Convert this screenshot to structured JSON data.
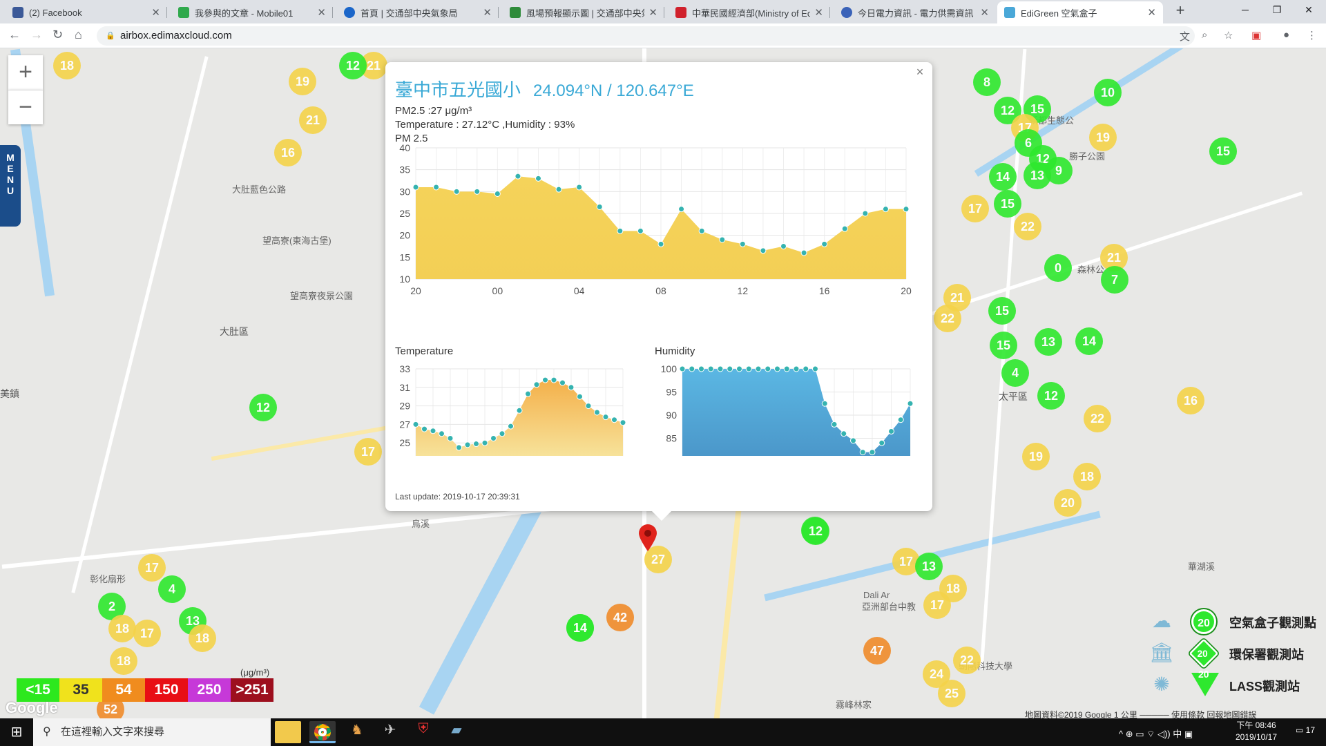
{
  "browser": {
    "tabs": [
      {
        "label": "(2) Facebook",
        "color": "#3b5998"
      },
      {
        "label": "我參與的文章 - Mobile01",
        "color": "#2fa94c"
      },
      {
        "label": "首頁 | 交通部中央氣象局",
        "color": "#1b66c9"
      },
      {
        "label": "風場預報顯示圖 | 交通部中央氣象",
        "color": "#2e8b3a"
      },
      {
        "label": "中華民國經濟部(Ministry of Eco",
        "color": "#d0212c"
      },
      {
        "label": "今日電力資訊 - 電力供需資訊 - 台",
        "color": "#3a62b8"
      },
      {
        "label": "EdiGreen 空氣盒子",
        "color": "#4aa8d8"
      }
    ],
    "new_tab": "+",
    "url": "airbox.edimaxcloud.com"
  },
  "map": {
    "labels": [
      {
        "t": "大肚藍色公路"
      },
      {
        "t": "望高寮(東海古堡)"
      },
      {
        "t": "望高寮夜景公園"
      },
      {
        "t": "大肚區"
      },
      {
        "t": "美鎮"
      },
      {
        "t": "太平區"
      },
      {
        "t": "新都生態公"
      },
      {
        "t": "勝子公園"
      },
      {
        "t": "霧峰林家"
      },
      {
        "t": "亞洲部台中教"
      },
      {
        "t": "朝陽科技大學"
      },
      {
        "t": "Dali Ar"
      },
      {
        "t": "烏溪"
      },
      {
        "t": "華湖溪"
      },
      {
        "t": "森林公"
      },
      {
        "t": "彰化扇形"
      }
    ],
    "markers": [
      {
        "v": "18",
        "c": "y"
      },
      {
        "v": "19",
        "c": "y"
      },
      {
        "v": "21",
        "c": "y"
      },
      {
        "v": "16",
        "c": "y"
      },
      {
        "v": "12",
        "c": "g"
      },
      {
        "v": "21",
        "c": "y"
      },
      {
        "v": "12",
        "c": "g"
      },
      {
        "v": "17",
        "c": "y"
      },
      {
        "v": "17",
        "c": "y"
      },
      {
        "v": "4",
        "c": "g"
      },
      {
        "v": "2",
        "c": "g"
      },
      {
        "v": "18",
        "c": "y"
      },
      {
        "v": "17",
        "c": "y"
      },
      {
        "v": "13",
        "c": "g"
      },
      {
        "v": "18",
        "c": "y"
      },
      {
        "v": "18",
        "c": "y"
      },
      {
        "v": "14",
        "c": "g"
      },
      {
        "v": "42",
        "c": "o"
      },
      {
        "v": "27",
        "c": "y"
      },
      {
        "v": "12",
        "c": "g"
      },
      {
        "v": "17",
        "c": "y"
      },
      {
        "v": "13",
        "c": "g"
      },
      {
        "v": "18",
        "c": "y"
      },
      {
        "v": "17",
        "c": "y"
      },
      {
        "v": "47",
        "c": "o"
      },
      {
        "v": "22",
        "c": "y"
      },
      {
        "v": "24",
        "c": "y"
      },
      {
        "v": "25",
        "c": "y"
      },
      {
        "v": "8",
        "c": "g"
      },
      {
        "v": "10",
        "c": "g"
      },
      {
        "v": "12",
        "c": "g"
      },
      {
        "v": "15",
        "c": "g"
      },
      {
        "v": "17",
        "c": "y"
      },
      {
        "v": "19",
        "c": "y"
      },
      {
        "v": "15",
        "c": "g"
      },
      {
        "v": "6",
        "c": "g"
      },
      {
        "v": "12",
        "c": "g"
      },
      {
        "v": "9",
        "c": "g"
      },
      {
        "v": "13",
        "c": "g"
      },
      {
        "v": "14",
        "c": "g"
      },
      {
        "v": "17",
        "c": "y"
      },
      {
        "v": "15",
        "c": "g"
      },
      {
        "v": "22",
        "c": "y"
      },
      {
        "v": "0",
        "c": "g"
      },
      {
        "v": "21",
        "c": "y"
      },
      {
        "v": "7",
        "c": "g"
      },
      {
        "v": "21",
        "c": "y"
      },
      {
        "v": "22",
        "c": "y"
      },
      {
        "v": "15",
        "c": "g"
      },
      {
        "v": "15",
        "c": "g"
      },
      {
        "v": "13",
        "c": "g"
      },
      {
        "v": "14",
        "c": "g"
      },
      {
        "v": "4",
        "c": "g"
      },
      {
        "v": "12",
        "c": "g"
      },
      {
        "v": "22",
        "c": "y"
      },
      {
        "v": "19",
        "c": "y"
      },
      {
        "v": "18",
        "c": "y"
      },
      {
        "v": "20",
        "c": "y"
      },
      {
        "v": "16",
        "c": "y"
      },
      {
        "v": "14",
        "c": "g"
      },
      {
        "v": "12",
        "c": "g"
      },
      {
        "v": "52",
        "c": "o"
      }
    ],
    "menu_label": "MENU",
    "zoom_in": "+",
    "zoom_out": "−",
    "google": "Google",
    "footer": "地圖資料©2019 Google   1 公里 ─────   使用條款   回報地圖錯誤"
  },
  "popup": {
    "title": "臺中市五光國小",
    "coords": "24.094°N / 120.647°E",
    "pm_line": "PM2.5 :27 μg/m³",
    "env_line": "Temperature : 27.12°C ,Humidity : 93%",
    "close": "×",
    "last_update": "Last update: 2019-10-17 20:39:31"
  },
  "chart_data": [
    {
      "type": "area",
      "title": "PM 2.5",
      "color": "#f5d35a",
      "x": [
        "20",
        "21",
        "22",
        "23",
        "00",
        "01",
        "02",
        "03",
        "04",
        "05",
        "06",
        "07",
        "08",
        "09",
        "10",
        "11",
        "12",
        "13",
        "14",
        "15",
        "16",
        "17",
        "18",
        "19",
        "20"
      ],
      "y_ticks": [
        10,
        15,
        20,
        25,
        30,
        35,
        40
      ],
      "x_ticks": [
        "20",
        "00",
        "04",
        "08",
        "12",
        "16",
        "20"
      ],
      "ylim": [
        10,
        40
      ],
      "values": [
        31,
        31,
        30,
        30,
        29.5,
        33.5,
        33,
        30.5,
        31,
        26.5,
        21,
        21,
        18,
        26,
        21,
        19,
        18,
        16.5,
        17.5,
        16,
        18,
        21.5,
        25,
        26,
        26
      ]
    },
    {
      "type": "area",
      "title": "Temperature",
      "color": "#f4b04a",
      "y_ticks": [
        23,
        25,
        27,
        29,
        31,
        33
      ],
      "ylim": [
        23,
        33
      ],
      "values": [
        27,
        26.5,
        26.3,
        26,
        25.5,
        24.5,
        24.8,
        24.9,
        25,
        25.5,
        26,
        26.8,
        28.5,
        30.3,
        31.3,
        31.8,
        31.8,
        31.5,
        31,
        30,
        29,
        28.3,
        27.8,
        27.5,
        27.2
      ]
    },
    {
      "type": "area",
      "title": "Humidity",
      "color": "#5bb7e3",
      "y_ticks": [
        80,
        85,
        90,
        95,
        100
      ],
      "ylim": [
        80,
        100
      ],
      "values": [
        100,
        100,
        100,
        100,
        100,
        100,
        100,
        100,
        100,
        100,
        100,
        100,
        100,
        100,
        100,
        92.5,
        88,
        86,
        84.5,
        82,
        82,
        84,
        86.5,
        89,
        92.5
      ]
    }
  ],
  "legend": {
    "unit": "(μg/m³)",
    "scale": [
      {
        "label": "<15",
        "color": "#2de81e"
      },
      {
        "label": "35",
        "color": "#f0e21c"
      },
      {
        "label": "54",
        "color": "#f08c1e"
      },
      {
        "label": "150",
        "color": "#e80e14"
      },
      {
        "label": "250",
        "color": "#c639d8"
      },
      {
        "label": ">251",
        "color": "#9d0f1e"
      }
    ],
    "types": [
      {
        "label": "空氣盒子觀測點",
        "value": "20",
        "icon": "cloud-box-icon"
      },
      {
        "label": "環保署觀測站",
        "value": "20",
        "icon": "building-icon"
      },
      {
        "label": "LASS觀測站",
        "value": "20",
        "icon": "antenna-icon"
      }
    ]
  },
  "taskbar": {
    "search_placeholder": "在這裡輸入文字來搜尋",
    "time": "下午 08:46",
    "date": "2019/10/17",
    "tray": "^  ⊕  ▭  ⌔  ◁))  中  ▣",
    "notif": "17"
  }
}
